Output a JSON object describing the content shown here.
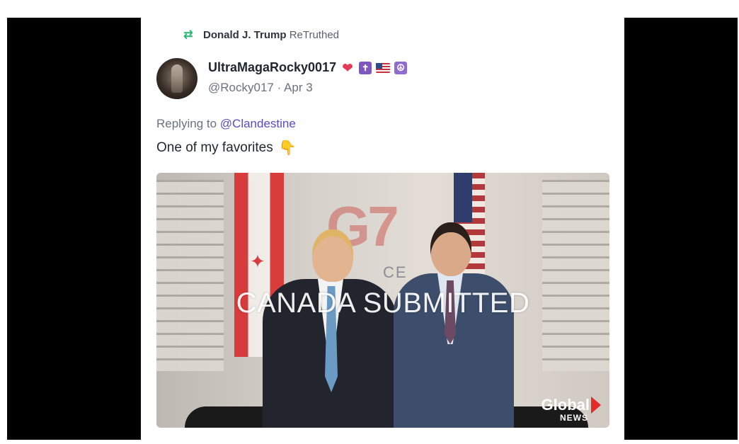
{
  "retruth": {
    "user": "Donald J. Trump",
    "label": "ReTruthed"
  },
  "post": {
    "display_name": "UltraMagaRocky0017",
    "handle": "@Rocky017",
    "separator": " · ",
    "date": "Apr 3",
    "replying_prefix": "Replying to ",
    "replying_to": "@Clandestine",
    "text": "One of my favorites",
    "emoji_icons": [
      "heart-icon",
      "cross-icon",
      "us-flag-icon",
      "peace-icon"
    ]
  },
  "media": {
    "backdrop_logo": "G7",
    "backdrop_sub": "CE",
    "caption": "CANADA SUBMITTED",
    "watermark_main": "Global",
    "watermark_sub": "NEWS"
  },
  "colors": {
    "retruth_green": "#2bb673",
    "mention_purple": "#5b4bc4",
    "logo_red": "#e22b2b"
  }
}
